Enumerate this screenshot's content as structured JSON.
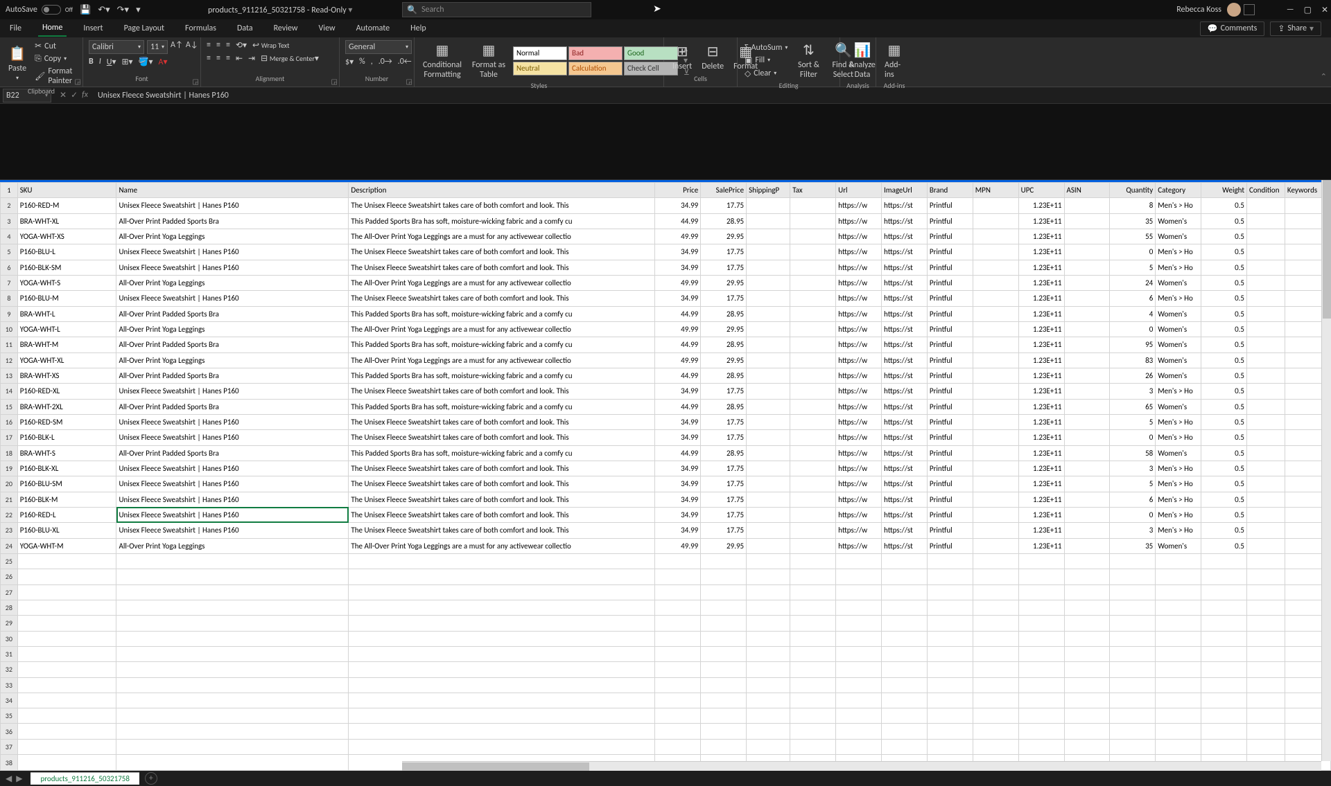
{
  "titlebar": {
    "autosave_label": "AutoSave",
    "autosave_state": "Off",
    "filename": "products_911216_50321758 - Read-Only",
    "search_placeholder": "Search",
    "user_name": "Rebecca Koss"
  },
  "tabs": {
    "file": "File",
    "home": "Home",
    "insert": "Insert",
    "pagelayout": "Page Layout",
    "formulas": "Formulas",
    "data": "Data",
    "review": "Review",
    "view": "View",
    "automate": "Automate",
    "help": "Help",
    "comments": "Comments",
    "share": "Share"
  },
  "ribbon": {
    "clipboard": {
      "paste": "Paste",
      "cut": "Cut",
      "copy": "Copy",
      "format_painter": "Format Painter",
      "label": "Clipboard"
    },
    "font": {
      "name": "Calibri",
      "size": "11",
      "label": "Font"
    },
    "alignment": {
      "wrap": "Wrap Text",
      "merge": "Merge & Center",
      "label": "Alignment"
    },
    "number": {
      "format": "General",
      "label": "Number"
    },
    "styles": {
      "conditional": "Conditional Formatting",
      "formatas": "Format as Table",
      "normal": "Normal",
      "bad": "Bad",
      "good": "Good",
      "neutral": "Neutral",
      "calc": "Calculation",
      "check": "Check Cell",
      "label": "Styles"
    },
    "cells": {
      "insert": "Insert",
      "delete": "Delete",
      "format": "Format",
      "label": "Cells"
    },
    "editing": {
      "autosum": "AutoSum",
      "fill": "Fill",
      "clear": "Clear",
      "sort": "Sort & Filter",
      "find": "Find & Select",
      "label": "Editing"
    },
    "analysis": {
      "analyze": "Analyze Data",
      "label": "Analysis"
    },
    "addins": {
      "addins": "Add-ins",
      "label": "Add-ins"
    }
  },
  "namebox": "B22",
  "formula": "Unisex Fleece Sweatshirt | Hanes P160",
  "sheet_tab": "products_911216_50321758",
  "headers": [
    "SKU",
    "Name",
    "Description",
    "Price",
    "SalePrice",
    "ShippingP",
    "Tax",
    "Url",
    "ImageUrl",
    "Brand",
    "MPN",
    "UPC",
    "ASIN",
    "Quantity",
    "Category",
    "Weight",
    "Condition",
    "Keywords"
  ],
  "selected_cell": {
    "row": 22,
    "col": 1
  },
  "rows": [
    {
      "n": 2,
      "sku": "P160-RED-M",
      "name": "Unisex Fleece Sweatshirt | Hanes P160",
      "desc": "The Unisex Fleece Sweatshirt takes care of both comfort and look. This",
      "price": "34.99",
      "sale": "17.75",
      "url": "https://w",
      "img": "https://st",
      "brand": "Printful",
      "upc": "1.23E+11",
      "qty": "8",
      "cat": "Men's > Ho",
      "wt": "0.5"
    },
    {
      "n": 3,
      "sku": "BRA-WHT-XL",
      "name": "All-Over Print Padded Sports Bra",
      "desc": "This Padded Sports Bra has soft, moisture-wicking fabric and a comfy cu",
      "price": "44.99",
      "sale": "28.95",
      "url": "https://w",
      "img": "https://st",
      "brand": "Printful",
      "upc": "1.23E+11",
      "qty": "35",
      "cat": "Women's",
      "wt": "0.5"
    },
    {
      "n": 4,
      "sku": "YOGA-WHT-XS",
      "name": "All-Over Print Yoga Leggings",
      "desc": "The All-Over Print Yoga Leggings are a must for any activewear collectio",
      "price": "49.99",
      "sale": "29.95",
      "url": "https://w",
      "img": "https://st",
      "brand": "Printful",
      "upc": "1.23E+11",
      "qty": "55",
      "cat": "Women's",
      "wt": "0.5"
    },
    {
      "n": 5,
      "sku": "P160-BLU-L",
      "name": "Unisex Fleece Sweatshirt | Hanes P160",
      "desc": "The Unisex Fleece Sweatshirt takes care of both comfort and look. This",
      "price": "34.99",
      "sale": "17.75",
      "url": "https://w",
      "img": "https://st",
      "brand": "Printful",
      "upc": "1.23E+11",
      "qty": "0",
      "cat": "Men's > Ho",
      "wt": "0.5"
    },
    {
      "n": 6,
      "sku": "P160-BLK-SM",
      "name": "Unisex Fleece Sweatshirt | Hanes P160",
      "desc": "The Unisex Fleece Sweatshirt takes care of both comfort and look. This",
      "price": "34.99",
      "sale": "17.75",
      "url": "https://w",
      "img": "https://st",
      "brand": "Printful",
      "upc": "1.23E+11",
      "qty": "5",
      "cat": "Men's > Ho",
      "wt": "0.5"
    },
    {
      "n": 7,
      "sku": "YOGA-WHT-S",
      "name": "All-Over Print Yoga Leggings",
      "desc": "The All-Over Print Yoga Leggings are a must for any activewear collectio",
      "price": "49.99",
      "sale": "29.95",
      "url": "https://w",
      "img": "https://st",
      "brand": "Printful",
      "upc": "1.23E+11",
      "qty": "24",
      "cat": "Women's",
      "wt": "0.5"
    },
    {
      "n": 8,
      "sku": "P160-BLU-M",
      "name": "Unisex Fleece Sweatshirt | Hanes P160",
      "desc": "The Unisex Fleece Sweatshirt takes care of both comfort and look. This",
      "price": "34.99",
      "sale": "17.75",
      "url": "https://w",
      "img": "https://st",
      "brand": "Printful",
      "upc": "1.23E+11",
      "qty": "6",
      "cat": "Men's > Ho",
      "wt": "0.5"
    },
    {
      "n": 9,
      "sku": "BRA-WHT-L",
      "name": "All-Over Print Padded Sports Bra",
      "desc": "This Padded Sports Bra has soft, moisture-wicking fabric and a comfy cu",
      "price": "44.99",
      "sale": "28.95",
      "url": "https://w",
      "img": "https://st",
      "brand": "Printful",
      "upc": "1.23E+11",
      "qty": "4",
      "cat": "Women's",
      "wt": "0.5"
    },
    {
      "n": 10,
      "sku": "YOGA-WHT-L",
      "name": "All-Over Print Yoga Leggings",
      "desc": "The All-Over Print Yoga Leggings are a must for any activewear collectio",
      "price": "49.99",
      "sale": "29.95",
      "url": "https://w",
      "img": "https://st",
      "brand": "Printful",
      "upc": "1.23E+11",
      "qty": "0",
      "cat": "Women's",
      "wt": "0.5"
    },
    {
      "n": 11,
      "sku": "BRA-WHT-M",
      "name": "All-Over Print Padded Sports Bra",
      "desc": "This Padded Sports Bra has soft, moisture-wicking fabric and a comfy cu",
      "price": "44.99",
      "sale": "28.95",
      "url": "https://w",
      "img": "https://st",
      "brand": "Printful",
      "upc": "1.23E+11",
      "qty": "95",
      "cat": "Women's",
      "wt": "0.5"
    },
    {
      "n": 12,
      "sku": "YOGA-WHT-XL",
      "name": "All-Over Print Yoga Leggings",
      "desc": "The All-Over Print Yoga Leggings are a must for any activewear collectio",
      "price": "49.99",
      "sale": "29.95",
      "url": "https://w",
      "img": "https://st",
      "brand": "Printful",
      "upc": "1.23E+11",
      "qty": "83",
      "cat": "Women's",
      "wt": "0.5"
    },
    {
      "n": 13,
      "sku": "BRA-WHT-XS",
      "name": "All-Over Print Padded Sports Bra",
      "desc": "This Padded Sports Bra has soft, moisture-wicking fabric and a comfy cu",
      "price": "44.99",
      "sale": "28.95",
      "url": "https://w",
      "img": "https://st",
      "brand": "Printful",
      "upc": "1.23E+11",
      "qty": "26",
      "cat": "Women's",
      "wt": "0.5"
    },
    {
      "n": 14,
      "sku": "P160-RED-XL",
      "name": "Unisex Fleece Sweatshirt | Hanes P160",
      "desc": "The Unisex Fleece Sweatshirt takes care of both comfort and look. This",
      "price": "34.99",
      "sale": "17.75",
      "url": "https://w",
      "img": "https://st",
      "brand": "Printful",
      "upc": "1.23E+11",
      "qty": "3",
      "cat": "Men's > Ho",
      "wt": "0.5"
    },
    {
      "n": 15,
      "sku": "BRA-WHT-2XL",
      "name": "All-Over Print Padded Sports Bra",
      "desc": "This Padded Sports Bra has soft, moisture-wicking fabric and a comfy cu",
      "price": "44.99",
      "sale": "28.95",
      "url": "https://w",
      "img": "https://st",
      "brand": "Printful",
      "upc": "1.23E+11",
      "qty": "65",
      "cat": "Women's",
      "wt": "0.5"
    },
    {
      "n": 16,
      "sku": "P160-RED-SM",
      "name": "Unisex Fleece Sweatshirt | Hanes P160",
      "desc": "The Unisex Fleece Sweatshirt takes care of both comfort and look. This",
      "price": "34.99",
      "sale": "17.75",
      "url": "https://w",
      "img": "https://st",
      "brand": "Printful",
      "upc": "1.23E+11",
      "qty": "5",
      "cat": "Men's > Ho",
      "wt": "0.5"
    },
    {
      "n": 17,
      "sku": "P160-BLK-L",
      "name": "Unisex Fleece Sweatshirt | Hanes P160",
      "desc": "The Unisex Fleece Sweatshirt takes care of both comfort and look. This",
      "price": "34.99",
      "sale": "17.75",
      "url": "https://w",
      "img": "https://st",
      "brand": "Printful",
      "upc": "1.23E+11",
      "qty": "0",
      "cat": "Men's > Ho",
      "wt": "0.5"
    },
    {
      "n": 18,
      "sku": "BRA-WHT-S",
      "name": "All-Over Print Padded Sports Bra",
      "desc": "This Padded Sports Bra has soft, moisture-wicking fabric and a comfy cu",
      "price": "44.99",
      "sale": "28.95",
      "url": "https://w",
      "img": "https://st",
      "brand": "Printful",
      "upc": "1.23E+11",
      "qty": "58",
      "cat": "Women's",
      "wt": "0.5"
    },
    {
      "n": 19,
      "sku": "P160-BLK-XL",
      "name": "Unisex Fleece Sweatshirt | Hanes P160",
      "desc": "The Unisex Fleece Sweatshirt takes care of both comfort and look. This",
      "price": "34.99",
      "sale": "17.75",
      "url": "https://w",
      "img": "https://st",
      "brand": "Printful",
      "upc": "1.23E+11",
      "qty": "3",
      "cat": "Men's > Ho",
      "wt": "0.5"
    },
    {
      "n": 20,
      "sku": "P160-BLU-SM",
      "name": "Unisex Fleece Sweatshirt | Hanes P160",
      "desc": "The Unisex Fleece Sweatshirt takes care of both comfort and look. This",
      "price": "34.99",
      "sale": "17.75",
      "url": "https://w",
      "img": "https://st",
      "brand": "Printful",
      "upc": "1.23E+11",
      "qty": "5",
      "cat": "Men's > Ho",
      "wt": "0.5"
    },
    {
      "n": 21,
      "sku": "P160-BLK-M",
      "name": "Unisex Fleece Sweatshirt | Hanes P160",
      "desc": "The Unisex Fleece Sweatshirt takes care of both comfort and look. This",
      "price": "34.99",
      "sale": "17.75",
      "url": "https://w",
      "img": "https://st",
      "brand": "Printful",
      "upc": "1.23E+11",
      "qty": "6",
      "cat": "Men's > Ho",
      "wt": "0.5"
    },
    {
      "n": 22,
      "sku": "P160-RED-L",
      "name": "Unisex Fleece Sweatshirt | Hanes P160",
      "desc": "The Unisex Fleece Sweatshirt takes care of both comfort and look. This",
      "price": "34.99",
      "sale": "17.75",
      "url": "https://w",
      "img": "https://st",
      "brand": "Printful",
      "upc": "1.23E+11",
      "qty": "0",
      "cat": "Men's > Ho",
      "wt": "0.5"
    },
    {
      "n": 23,
      "sku": "P160-BLU-XL",
      "name": "Unisex Fleece Sweatshirt | Hanes P160",
      "desc": "The Unisex Fleece Sweatshirt takes care of both comfort and look. This",
      "price": "34.99",
      "sale": "17.75",
      "url": "https://w",
      "img": "https://st",
      "brand": "Printful",
      "upc": "1.23E+11",
      "qty": "3",
      "cat": "Men's > Ho",
      "wt": "0.5"
    },
    {
      "n": 24,
      "sku": "YOGA-WHT-M",
      "name": "All-Over Print Yoga Leggings",
      "desc": "The All-Over Print Yoga Leggings are a must for any activewear collectio",
      "price": "49.99",
      "sale": "29.95",
      "url": "https://w",
      "img": "https://st",
      "brand": "Printful",
      "upc": "1.23E+11",
      "qty": "35",
      "cat": "Women's",
      "wt": "0.5"
    }
  ],
  "empty_rows": [
    25,
    26,
    27,
    28,
    29,
    30,
    31,
    32,
    33,
    34,
    35,
    36,
    37,
    38
  ]
}
